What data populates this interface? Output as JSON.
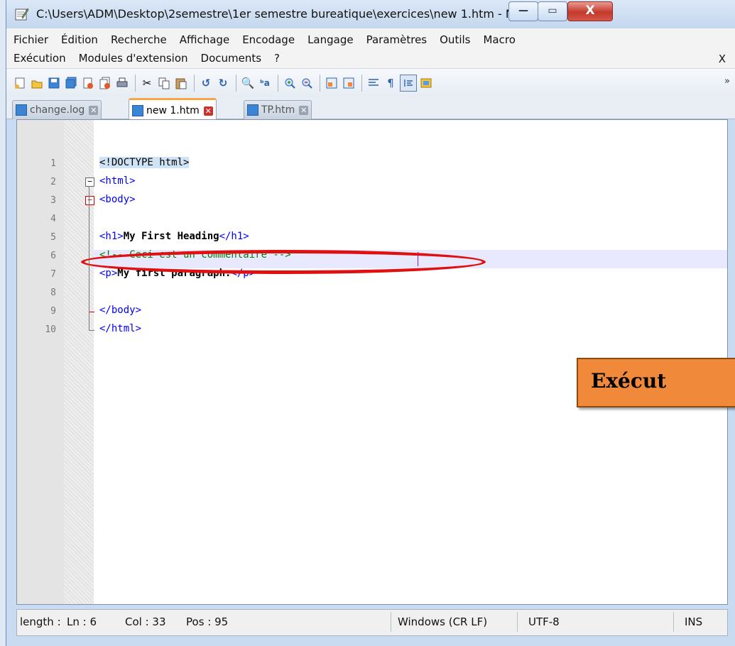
{
  "window": {
    "title": "C:\\Users\\ADM\\Desktop\\2semestre\\1er semestre bureatique\\exercices\\new 1.htm - N...",
    "controls": {
      "minimize": "—",
      "maximize": "▭",
      "close": "X"
    }
  },
  "menubar": {
    "row1": [
      "Fichier",
      "Édition",
      "Recherche",
      "Affichage",
      "Encodage",
      "Langage",
      "Paramètres",
      "Outils",
      "Macro"
    ],
    "row2": [
      "Exécution",
      "Modules d'extension",
      "Documents",
      "?"
    ],
    "close_doc": "X"
  },
  "toolbar": {
    "icons": [
      "new-file-icon",
      "open-file-icon",
      "save-icon",
      "save-all-icon",
      "close-icon",
      "close-all-icon",
      "print-icon",
      "cut-icon",
      "copy-icon",
      "paste-icon",
      "undo-icon",
      "redo-icon",
      "find-icon",
      "replace-icon",
      "zoom-in-icon",
      "zoom-out-icon",
      "sync-vertical-icon",
      "sync-horizontal-icon",
      "word-wrap-icon",
      "show-all-chars-icon",
      "indent-guide-icon",
      "macro-icon"
    ],
    "more": "»"
  },
  "tabs": [
    {
      "label": "change.log",
      "active": false
    },
    {
      "label": "new 1.htm",
      "active": true
    },
    {
      "label": "TP.htm",
      "active": false
    }
  ],
  "editor": {
    "lines": [
      {
        "num": "1"
      },
      {
        "num": "2"
      },
      {
        "num": "3"
      },
      {
        "num": "4"
      },
      {
        "num": "5"
      },
      {
        "num": "6"
      },
      {
        "num": "7"
      },
      {
        "num": "8"
      },
      {
        "num": "9"
      },
      {
        "num": "10"
      }
    ],
    "code": {
      "l1": "<!DOCTYPE html>",
      "l2": "<html>",
      "l3": "<body>",
      "l5_open": "<h1>",
      "l5_text": "My First Heading",
      "l5_close": "</h1>",
      "l6": "<!-- Ceci est un commentaire -->",
      "l7_open": "<p>",
      "l7_text": "My first paragraph.",
      "l7_close": "</p>",
      "l9": "</body>",
      "l10": "</html>"
    }
  },
  "overlay": {
    "label": "Exécut"
  },
  "statusbar": {
    "length": "length :",
    "ln": "Ln : 6",
    "col": "Col : 33",
    "pos": "Pos : 95",
    "eol": "Windows (CR LF)",
    "encoding": "UTF-8",
    "mode": "INS"
  },
  "colors": {
    "tag": "#0000ff",
    "comment": "#008000",
    "current_line": "#e8e8ff",
    "highlight_ellipse": "#e01010",
    "badge": "#f08a3a"
  }
}
